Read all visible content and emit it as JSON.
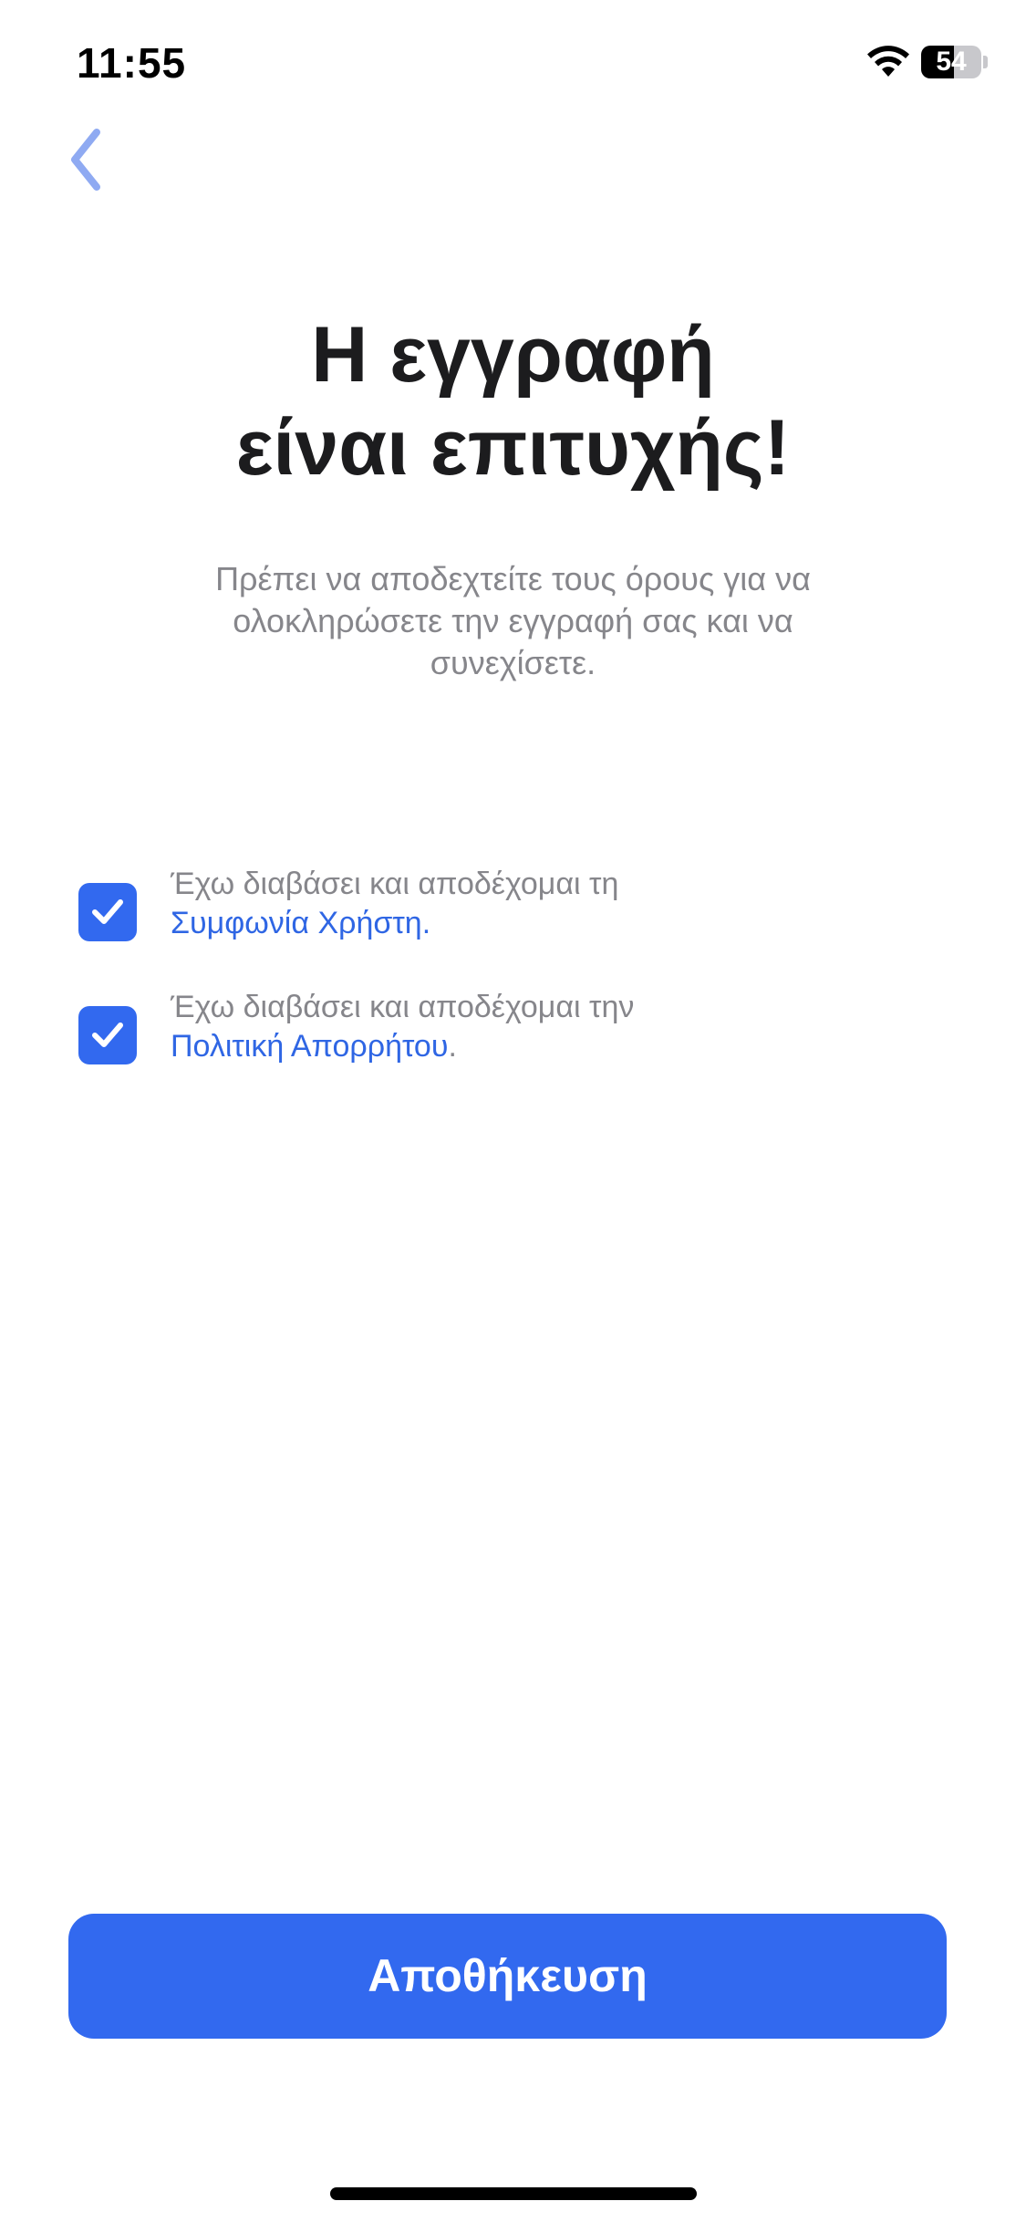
{
  "status_bar": {
    "time": "11:55",
    "battery_level": "54",
    "battery_fraction": 0.54,
    "wifi_icon": "wifi-icon",
    "battery_icon": "battery-icon"
  },
  "navigation": {
    "back_icon": "chevron-left-icon",
    "back_color": "#8faaf2"
  },
  "header": {
    "title_line1": "Η εγγραφή",
    "title_line2": "είναι επιτυχής!",
    "subtitle_line1": "Πρέπει να αποδεχτείτε τους όρους για να",
    "subtitle_line2": "ολοκληρώσετε την εγγραφή σας και να",
    "subtitle_line3": "συνεχίσετε."
  },
  "terms": [
    {
      "checked": true,
      "text": "Έχω διαβάσει και αποδέχομαι τη",
      "link": "Συμφωνία Χρήστη.",
      "suffix": ""
    },
    {
      "checked": true,
      "text": "Έχω διαβάσει και αποδέχομαι την",
      "link": "Πολιτική Απορρήτου",
      "suffix": "."
    }
  ],
  "actions": {
    "save_label": "Αποθήκευση"
  },
  "colors": {
    "accent": "#3269ef",
    "link": "#2f66e4",
    "title": "#1c1c1e",
    "secondary_text": "#86868b",
    "background": "#ffffff"
  }
}
